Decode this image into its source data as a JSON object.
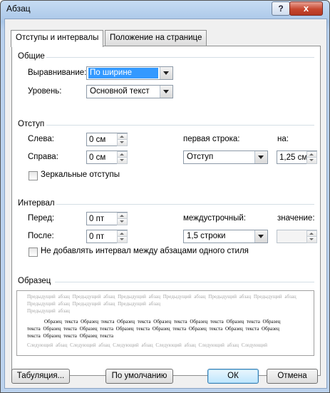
{
  "window": {
    "title": "Абзац",
    "help_label": "?",
    "close_label": "x"
  },
  "tabs": [
    {
      "label": "Отступы и интервалы",
      "active": true
    },
    {
      "label": "Положение на странице",
      "active": false
    }
  ],
  "general": {
    "heading": "Общие",
    "alignment_label": "Выравнивание:",
    "alignment_value": "По ширине",
    "level_label": "Уровень:",
    "level_value": "Основной текст"
  },
  "indent": {
    "heading": "Отступ",
    "left_label": "Слева:",
    "left_value": "0 см",
    "right_label": "Справа:",
    "right_value": "0 см",
    "first_line_label": "первая строка:",
    "first_line_value": "Отступ",
    "by_label": "на:",
    "by_value": "1,25 см",
    "mirror_label": "Зеркальные отступы"
  },
  "spacing": {
    "heading": "Интервал",
    "before_label": "Перед:",
    "before_value": "0 пт",
    "after_label": "После:",
    "after_value": "0 пт",
    "line_label": "междустрочный:",
    "line_value": "1,5 строки",
    "at_label": "значение:",
    "at_value": "",
    "no_space_label": "Не добавлять интервал между абзацами одного стиля"
  },
  "preview": {
    "heading": "Образец",
    "prev_lines": [
      "Предыдущий абзац Предыдущий абзац Предыдущий абзац Предыдущий абзац Предыдущий абзац Предыдущий абзац Предыдущий абзац Предыдущий абзац Предыдущий абзац",
      "Предыдущий абзац"
    ],
    "sample_lines": [
      "Образец текста Образец текста Образец текста Образец текста Образец текста Образец текста Образец",
      "текста Образец текста Образец текста Образец текста Образец текста Образец текста Образец текста Образец",
      "текста Образец текста Образец текста"
    ],
    "next_line": "Следующий абзац Следующий абзац Следующий абзац Следующий абзац Следующий абзац Следующий"
  },
  "buttons": {
    "tabs": "Табуляция...",
    "default": "По умолчанию",
    "ok": "ОК",
    "cancel": "Отмена"
  },
  "colors": {
    "accent": "#3399ff",
    "close": "#c7472f"
  }
}
